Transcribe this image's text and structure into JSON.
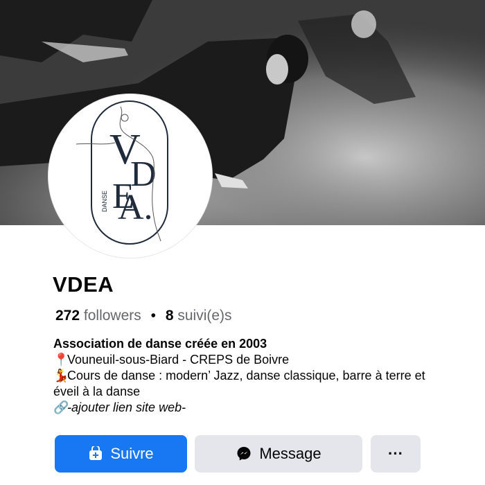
{
  "profile": {
    "name": "VDEA",
    "followers_count": "272",
    "followers_label": "followers",
    "separator": "•",
    "following_count": "8",
    "following_label": "suivi(e)s"
  },
  "logo": {
    "text_main": "VDEA.",
    "text_side": "DANSE"
  },
  "bio": {
    "title": "Association de danse créée en 2003",
    "location_emoji": "📍",
    "location": "Vouneuil-sous-Biard - CREPS de Boivre",
    "dance_emoji": "💃",
    "courses": "Cours de danse : modern’ Jazz, danse classique, barre à terre et éveil à la danse",
    "link_emoji": "🔗",
    "link": "-ajouter lien site web-"
  },
  "actions": {
    "follow_label": "Suivre",
    "message_label": "Message",
    "more_label": "···"
  },
  "colors": {
    "follow_bg": "#1877f2",
    "secondary_bg": "#e4e6eb",
    "text": "#050505",
    "muted": "#65676b"
  },
  "icons": {
    "follow": "follow-plus-icon",
    "message": "messenger-icon",
    "more": "more-dots-icon",
    "location": "pin-icon",
    "dance": "dancer-icon",
    "link": "link-icon"
  }
}
